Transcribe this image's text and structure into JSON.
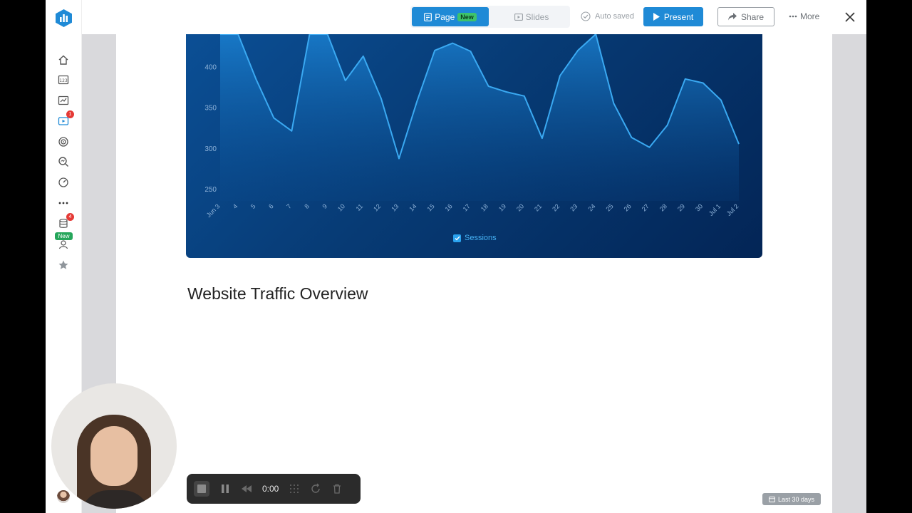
{
  "topbar": {
    "page_label": "Page",
    "page_badge": "New",
    "slides_label": "Slides",
    "autosave_status": "Auto saved",
    "present_label": "Present",
    "share_label": "Share",
    "more_label": "More"
  },
  "rail": {
    "badge_1": "1",
    "badge_2": "4",
    "new_tag": "New"
  },
  "section_title": "Website Traffic Overview",
  "recorder": {
    "time": "0:00"
  },
  "date_range": "Last 30 days",
  "colors": {
    "accent": "#1f8ad6",
    "line": "#3aa9f2",
    "card_bg": "#073b75"
  },
  "chart_data": {
    "type": "area",
    "title": "",
    "xlabel": "",
    "ylabel": "",
    "ylim": [
      235,
      440
    ],
    "yticks": [
      250,
      300,
      350,
      400
    ],
    "categories": [
      "Jun 3",
      "4",
      "5",
      "6",
      "7",
      "8",
      "9",
      "10",
      "11",
      "12",
      "13",
      "14",
      "15",
      "16",
      "17",
      "18",
      "19",
      "20",
      "21",
      "22",
      "23",
      "24",
      "25",
      "26",
      "27",
      "28",
      "29",
      "30",
      "Jul 1",
      "Jul 2"
    ],
    "series": [
      {
        "name": "Sessions",
        "values": [
          450,
          440,
          385,
          337,
          321,
          450,
          450,
          383,
          413,
          361,
          287,
          357,
          420,
          429,
          419,
          376,
          369,
          364,
          312,
          389,
          420,
          450,
          355,
          313,
          301,
          328,
          385,
          380,
          359,
          305
        ]
      }
    ],
    "legend": "bottom-center",
    "grid": false
  }
}
